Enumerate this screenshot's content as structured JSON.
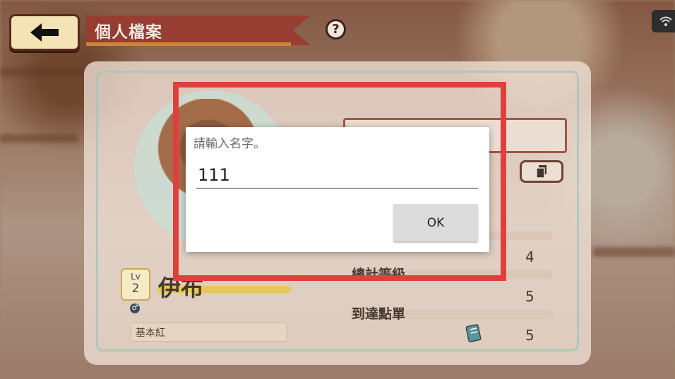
{
  "header": {
    "title": "個人檔案",
    "help_label": "?"
  },
  "profile": {
    "level_label": "Lv",
    "level": "2",
    "gender": "♂",
    "pokemon_name": "伊布",
    "ribbon_label": "基本紅"
  },
  "stats": [
    {
      "label": "總計等級",
      "value": "4"
    },
    {
      "label": "到達點單",
      "value": "5"
    },
    {
      "label": "",
      "value": "5"
    }
  ],
  "dialog": {
    "title": "請輸入名字。",
    "input_value": "111",
    "ok_label": "OK"
  },
  "colors": {
    "highlight": "#e0403c",
    "title_ribbon": "#9a3a30"
  }
}
